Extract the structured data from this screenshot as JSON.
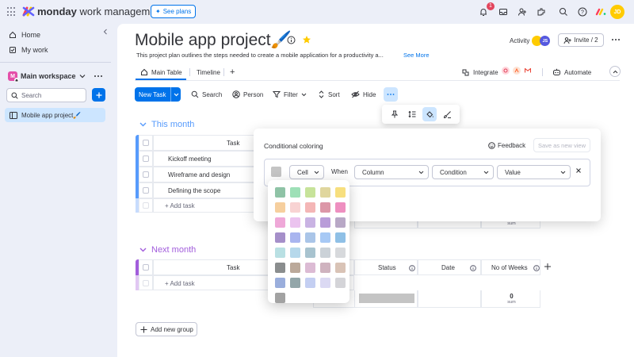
{
  "topbar": {
    "brand_bold": "monday",
    "brand_rest": " work management",
    "see_plans": "See plans",
    "notification_count": "1",
    "user_initials": "JD",
    "icons": [
      "notification-bell-icon",
      "inbox-icon",
      "invite-members-icon",
      "apps-marketplace-icon",
      "search-icon",
      "help-icon",
      "monday-logo-icon"
    ]
  },
  "sidebar": {
    "home": "Home",
    "my_work": "My work",
    "workspace_initial": "M",
    "workspace_name": "Main workspace",
    "search_placeholder": "Search",
    "board_name": "Mobile app project🖌️"
  },
  "header": {
    "title": "Mobile app project🖌️",
    "description": "This project plan outlines the steps needed to create a mobile application for a productivity a...",
    "see_more": "See More",
    "activity": "Activity",
    "activity_avatar_2": "JS",
    "invite": "Invite / 2"
  },
  "tabs": {
    "main_table": "Main Table",
    "timeline": "Timeline",
    "add": "+",
    "integrate": "Integrate",
    "automate": "Automate"
  },
  "toolbar": {
    "new_task": "New Task",
    "search": "Search",
    "person": "Person",
    "filter": "Filter",
    "sort": "Sort",
    "hide": "Hide",
    "more": "···"
  },
  "groups": [
    {
      "title": "This month",
      "color": "#579bfc",
      "column_task": "Task",
      "rows": [
        "Kickoff meeting",
        "Wireframe and design",
        "Defining the scope"
      ],
      "add_task": "+ Add task",
      "summary_number": "",
      "summary_label": "sum",
      "status_bar_colors": [
        "#00c875",
        "#fdab3d",
        "#579bfc"
      ]
    },
    {
      "title": "Next month",
      "color": "#a25ddc",
      "column_task": "Task",
      "column_status": "Status",
      "column_date": "Date",
      "column_weeks": "No of Weeks",
      "add_task": "+ Add task",
      "summary_number": "0",
      "summary_label": "sum"
    }
  ],
  "add_group": "Add new group",
  "conditional_coloring": {
    "title": "Conditional coloring",
    "feedback": "Feedback",
    "save_as_new_view": "Save as new view",
    "apply_to": "Cell",
    "when": "When",
    "column_placeholder": "Column",
    "condition_placeholder": "Condition",
    "value_placeholder": "Value",
    "current_color": "#c4c4c4"
  },
  "palette": {
    "colors": [
      [
        "#8fc3a6",
        "#9ee0b7",
        "#c7e39a",
        "#e0d69e",
        "#f7df7e"
      ],
      [
        "#f6cf9e",
        "#f8d3d3",
        "#f4b6b6",
        "#dc97a8",
        "#ee8fc0"
      ],
      [
        "#efa8d8",
        "#ebc3ef",
        "#c9b3e3",
        "#b99dd9",
        "#b8a8c6"
      ],
      [
        "#a58fc9",
        "#a9b5ef",
        "#aac5e8",
        "#a7c9f5",
        "#8fc0e6"
      ],
      [
        "#b9e0e3",
        "#b6d8eb",
        "#a8c3cf",
        "#cbd2d8",
        "#d7d9dc"
      ],
      [
        "#8a8d8e",
        "#bba99a",
        "#dcbbd4",
        "#cfb3bf",
        "#d9c3b6"
      ],
      [
        "#9aaedc",
        "#93a6a9",
        "#c4cff2",
        "#dbd9f3",
        "#d4d4d8"
      ],
      [
        "#a2a2a2"
      ]
    ]
  }
}
